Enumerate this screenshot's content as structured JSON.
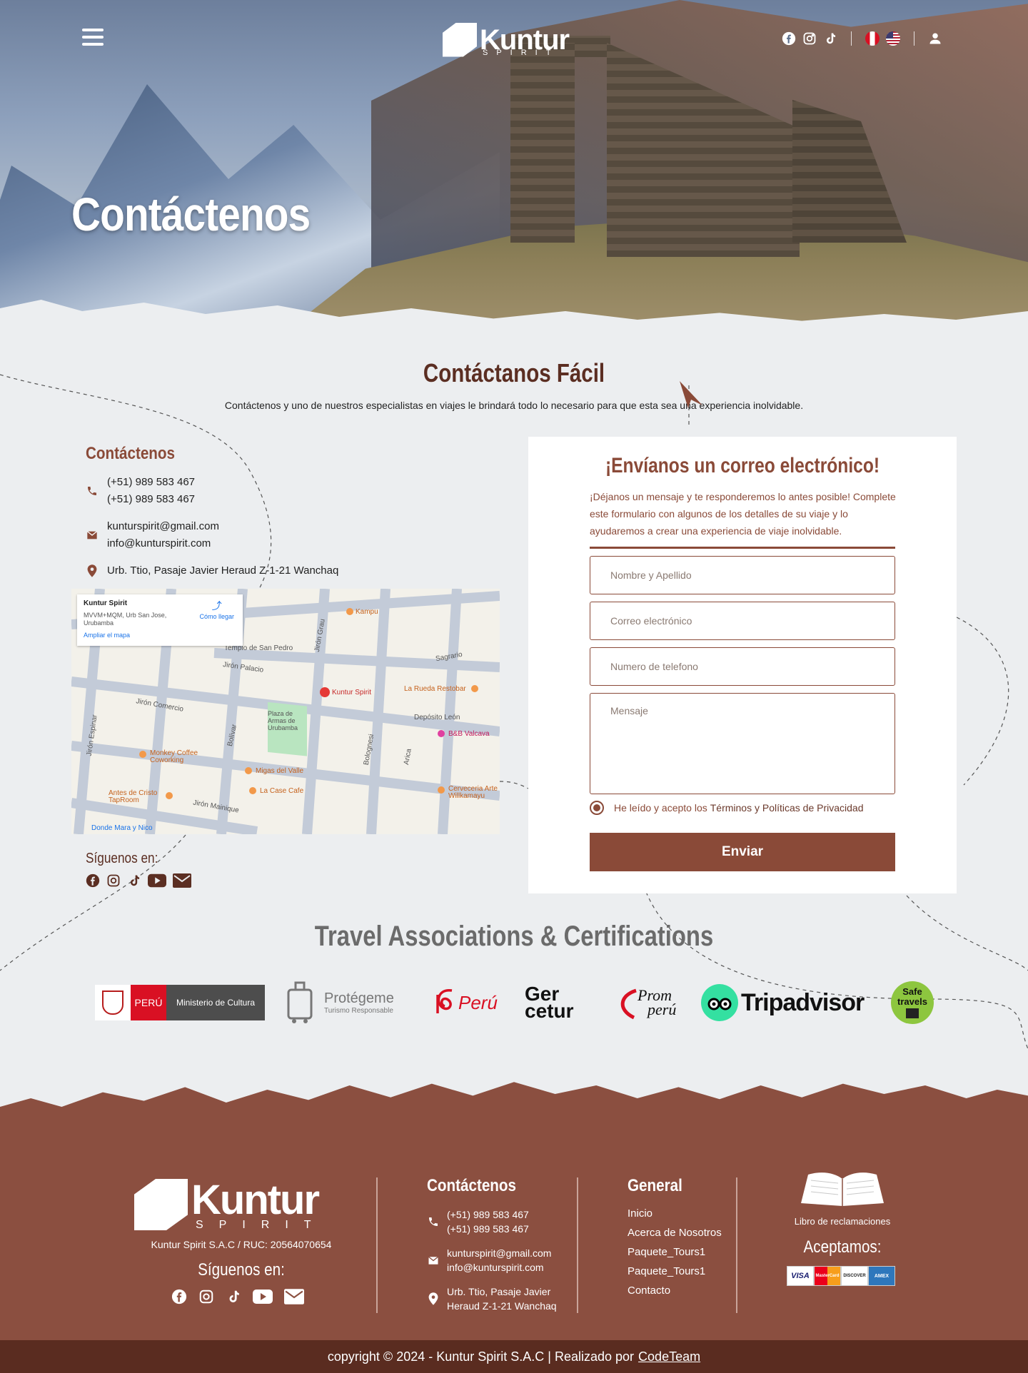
{
  "header": {
    "logo_text": "Kuntur",
    "logo_sub": "SPIRIT",
    "menu_icon": "hamburger-icon",
    "social_icons": [
      "facebook-icon",
      "instagram-icon",
      "tiktok-icon"
    ],
    "languages": [
      "es-flag-icon",
      "en-flag-icon"
    ],
    "user_icon": "user-icon"
  },
  "hero": {
    "title": "Contáctenos"
  },
  "section": {
    "title": "Contáctanos Fácil",
    "subtitle": "Contáctenos y uno de nuestros especialistas en viajes le brindará todo lo necesario para que esta sea una experiencia inolvidable."
  },
  "contact": {
    "heading": "Contáctenos",
    "phone1": "(+51) 989 583 467",
    "phone2": "(+51) 989 583 467",
    "email1": "kunturspirit@gmail.com",
    "email2": "info@kunturspirit.com",
    "address": "Urb. Ttio, Pasaje Javier Heraud Z-1-21 Wanchaq"
  },
  "map": {
    "card_title": "Kuntur Spirit",
    "card_address": "MVVM+MQM, Urb San Jose, Urubamba",
    "card_link": "Ampliar el mapa",
    "directions": "Cómo llegar",
    "labels": [
      "Templo de San Pedro",
      "Jirón Palacio",
      "Jirón Comercio",
      "Plaza de Armas de Urubamba",
      "Depósito León",
      "Sagrario",
      "Bolívar",
      "Jirón Grau",
      "Bolognesi",
      "Arica",
      "Jirón Mainique",
      "Jirón Espinar",
      "Donde Mara y Nico"
    ],
    "pois": [
      "Kampu",
      "Kuntur Spirit",
      "La Rueda Restobar",
      "B&B Valcava",
      "Monkey Coffee Coworking",
      "Migas del Valle",
      "La Case Cafe",
      "Antes de Cristo TapRoom",
      "Cerveceria Arte Willkamayu"
    ]
  },
  "follow": {
    "label": "Síguenos en:",
    "icons": [
      "facebook-icon",
      "instagram-icon",
      "tiktok-icon",
      "youtube-icon",
      "mail-icon"
    ]
  },
  "form": {
    "title": "¡Envíanos un correo electrónico!",
    "description": "¡Déjanos un mensaje y te responderemos lo antes posible! Complete este formulario con algunos de los detalles de su viaje y lo ayudaremos a crear una experiencia de viaje inolvidable.",
    "name_placeholder": "Nombre y Apellido",
    "email_placeholder": "Correo electrónico",
    "phone_placeholder": "Numero de telefono",
    "message_placeholder": "Mensaje",
    "terms_prefix": "He leído y acepto los",
    "terms_link": "Términos y Políticas de Privacidad",
    "submit": "Enviar"
  },
  "associations": {
    "title": "Travel Associations & Certifications",
    "cultura_peru": "PERÚ",
    "cultura_ministry": "Ministerio de Cultura",
    "protegeme_title": "Protégeme",
    "protegeme_sub": "Turismo Responsable",
    "peru_brand": "Perú",
    "gercetur_1": "Ger",
    "gercetur_2": "cetur",
    "promperu_1": "Prom",
    "promperu_2": "perú",
    "tripadvisor": "Tripadvisor",
    "safe_1": "Safe",
    "safe_2": "travels"
  },
  "footer": {
    "logo_text": "Kuntur",
    "logo_sub": "SPIRIT",
    "ruc": "Kuntur Spirit S.A.C / RUC: 20564070654",
    "follow": "Síguenos en:",
    "contact_heading": "Contáctenos",
    "phone1": "(+51) 989 583 467",
    "phone2": "(+51) 989 583 467",
    "email1": "kunturspirit@gmail.com",
    "email2": "info@kunturspirit.com",
    "address1": "Urb. Ttio, Pasaje Javier",
    "address2": "Heraud Z-1-21 Wanchaq",
    "general_heading": "General",
    "links": [
      "Inicio",
      "Acerca de Nosotros",
      "Paquete_Tours1",
      "Paquete_Tours1",
      "Contacto"
    ],
    "libro": "Libro de reclamaciones",
    "aceptamos": "Aceptamos:",
    "cards": [
      "VISA",
      "MasterCard",
      "DISCOVER",
      "AMEX"
    ]
  },
  "copyright": {
    "text": "copyright © 2024 - Kuntur Spirit S.A.C  |  Realizado por",
    "link": "CodeTeam"
  },
  "colors": {
    "brand": "#8a4a38",
    "dark": "#5b2e22",
    "footer": "#8b4f40",
    "copy_bar": "#5a2c20"
  }
}
